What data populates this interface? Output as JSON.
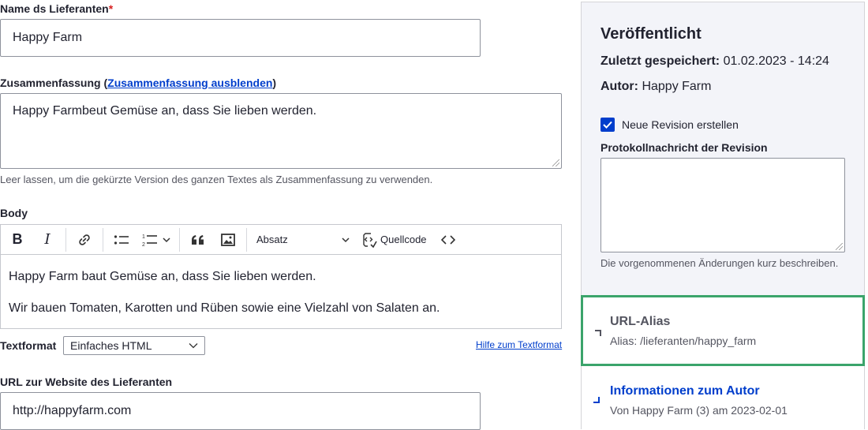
{
  "form": {
    "supplier_name": {
      "label": "Name ds Lieferanten",
      "required_mark": "*",
      "value": "Happy Farm"
    },
    "summary": {
      "label_prefix": "Zusammenfassung (",
      "toggle_link": "Zusammenfassung ausblenden",
      "label_suffix": ")",
      "value": "Happy Farmbeut Gemüse an, dass Sie lieben werden.",
      "description": "Leer lassen, um die gekürzte Version des ganzen Textes als Zusammenfassung zu verwenden."
    },
    "body": {
      "label": "Body",
      "toolbar": {
        "bold": "B",
        "italic": "I",
        "heading_select": "Absatz",
        "source_label": "Quellcode"
      },
      "paragraphs": [
        "Happy Farm baut Gemüse an, dass Sie lieben werden.",
        "Wir bauen Tomaten, Karotten und Rüben sowie eine Vielzahl von Salaten an."
      ]
    },
    "text_format": {
      "label": "Textformat",
      "selected": "Einfaches HTML",
      "help_link": "Hilfe zum Textformat"
    },
    "website": {
      "label": "URL zur Website des Lieferanten",
      "value": "http://happyfarm.com"
    }
  },
  "sidebar": {
    "status_title": "Veröffentlicht",
    "last_saved_label": "Zuletzt gespeichert:",
    "last_saved_value": "01.02.2023 - 14:24",
    "author_label": "Autor:",
    "author_value": "Happy Farm",
    "new_revision_label": "Neue Revision erstellen",
    "new_revision_checked": true,
    "revision_log_label": "Protokollnachricht der Revision",
    "revision_log_value": "",
    "revision_log_description": "Die vorgenommenen Änderungen kurz beschreiben.",
    "url_alias": {
      "title": "URL-Alias",
      "summary": "Alias: /lieferanten/happy_farm"
    },
    "author_info": {
      "title": "Informationen zum Autor",
      "summary": "Von Happy Farm (3) am 2023-02-01"
    }
  },
  "colors": {
    "accent": "#003ecc",
    "focus": "#3ba46b",
    "required": "#d72222"
  }
}
